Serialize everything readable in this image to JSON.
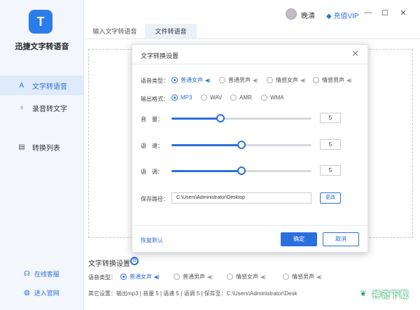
{
  "app": {
    "title": "迅捷文字转语音",
    "logo_glyph": "T"
  },
  "sidebar": {
    "items": [
      {
        "label": "文字转语音",
        "icon": "text-icon",
        "glyph": "A",
        "active": true
      },
      {
        "label": "录音转文字",
        "icon": "microphone-icon",
        "glyph": "♁",
        "active": false
      },
      {
        "label": "转换列表",
        "icon": "list-icon",
        "glyph": "▤",
        "active": false
      }
    ],
    "footer": [
      {
        "label": "在线客服",
        "icon": "headset-icon",
        "glyph": "☊"
      },
      {
        "label": "进入官网",
        "icon": "globe-icon",
        "glyph": "◍"
      }
    ]
  },
  "titlebar": {
    "username": "晚清",
    "vip_label": "充值VIP",
    "vip_icon": "diamond-icon",
    "buttons": {
      "minimize": "—",
      "maximize": "☐",
      "close": "✕"
    }
  },
  "tabs": [
    {
      "label": "输入文字转语音",
      "active": false
    },
    {
      "label": "文件转语音",
      "active": true
    }
  ],
  "dialog": {
    "title": "文字转换设置",
    "close": "✕",
    "voice_type": {
      "label": "语音类型：",
      "options": [
        {
          "label": "普通女声",
          "checked": true
        },
        {
          "label": "普通男声",
          "checked": false
        },
        {
          "label": "情感女声",
          "checked": false
        },
        {
          "label": "情感男声",
          "checked": false
        }
      ]
    },
    "output_format": {
      "label": "输出格式：",
      "options": [
        {
          "label": "MP3",
          "checked": true
        },
        {
          "label": "WAV",
          "checked": false
        },
        {
          "label": "AMR",
          "checked": false
        },
        {
          "label": "WMA",
          "checked": false
        }
      ]
    },
    "volume": {
      "label": "音　量：",
      "value": "5",
      "level": 0.35
    },
    "speed": {
      "label": "语　速：",
      "value": "5",
      "level": 0.5
    },
    "pitch": {
      "label": "语　调：",
      "value": "5",
      "level": 0.5
    },
    "save_path": {
      "label": "保存路径：",
      "value": "C:\\Users\\Administrator\\Desktop",
      "change_label": "更改"
    },
    "reset_label": "恢复默认",
    "ok_label": "确定",
    "cancel_label": "取消"
  },
  "bottom": {
    "title": "文字转换设置",
    "gear_icon": "settings-icon",
    "voice_type_label": "语音类型：",
    "voice_options": [
      {
        "label": "普通女声",
        "checked": true
      },
      {
        "label": "普通男声",
        "checked": false
      },
      {
        "label": "情感女声",
        "checked": false
      },
      {
        "label": "情感男声",
        "checked": false
      }
    ],
    "summary": "其它设置：输出mp3 | 音量 5 | 语速 5 | 语调 5 | 保存至：C:\\Users\\Administrator\\Desk"
  },
  "watermark": {
    "text": "神奇下载"
  },
  "speaker_glyph": "◀)"
}
